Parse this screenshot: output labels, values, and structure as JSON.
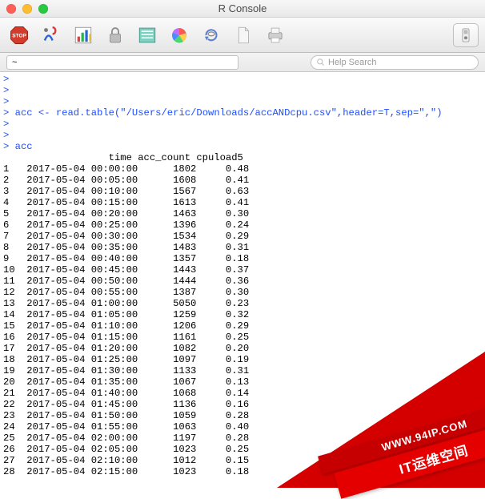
{
  "window": {
    "title": "R Console"
  },
  "toolbar": {
    "icons": {
      "stop": "stop-icon",
      "source": "source-icon",
      "chart": "chart-icon",
      "lock": "lock-icon",
      "list": "list-icon",
      "color": "color-icon",
      "refresh": "refresh-icon",
      "new": "newdoc-icon",
      "print": "print-icon",
      "prefs": "prefs-icon"
    }
  },
  "searchrow": {
    "path_value": "~",
    "help_placeholder": "Help Search"
  },
  "console": {
    "prompt": ">",
    "blank_prompts_before": 3,
    "command1": "acc <- read.table(\"/Users/eric/Downloads/accANDcpu.csv\",header=T,sep=\",\")",
    "blank_prompts_between": 2,
    "command2": "acc",
    "columns": [
      "time",
      "acc_count",
      "cpuload5"
    ],
    "rows": [
      {
        "i": "1",
        "time": "2017-05-04 00:00:00",
        "acc_count": "1802",
        "cpu": "0.48"
      },
      {
        "i": "2",
        "time": "2017-05-04 00:05:00",
        "acc_count": "1608",
        "cpu": "0.41"
      },
      {
        "i": "3",
        "time": "2017-05-04 00:10:00",
        "acc_count": "1567",
        "cpu": "0.63"
      },
      {
        "i": "4",
        "time": "2017-05-04 00:15:00",
        "acc_count": "1613",
        "cpu": "0.41"
      },
      {
        "i": "5",
        "time": "2017-05-04 00:20:00",
        "acc_count": "1463",
        "cpu": "0.30"
      },
      {
        "i": "6",
        "time": "2017-05-04 00:25:00",
        "acc_count": "1396",
        "cpu": "0.24"
      },
      {
        "i": "7",
        "time": "2017-05-04 00:30:00",
        "acc_count": "1534",
        "cpu": "0.29"
      },
      {
        "i": "8",
        "time": "2017-05-04 00:35:00",
        "acc_count": "1483",
        "cpu": "0.31"
      },
      {
        "i": "9",
        "time": "2017-05-04 00:40:00",
        "acc_count": "1357",
        "cpu": "0.18"
      },
      {
        "i": "10",
        "time": "2017-05-04 00:45:00",
        "acc_count": "1443",
        "cpu": "0.37"
      },
      {
        "i": "11",
        "time": "2017-05-04 00:50:00",
        "acc_count": "1444",
        "cpu": "0.36"
      },
      {
        "i": "12",
        "time": "2017-05-04 00:55:00",
        "acc_count": "1387",
        "cpu": "0.30"
      },
      {
        "i": "13",
        "time": "2017-05-04 01:00:00",
        "acc_count": "5050",
        "cpu": "0.23"
      },
      {
        "i": "14",
        "time": "2017-05-04 01:05:00",
        "acc_count": "1259",
        "cpu": "0.32"
      },
      {
        "i": "15",
        "time": "2017-05-04 01:10:00",
        "acc_count": "1206",
        "cpu": "0.29"
      },
      {
        "i": "16",
        "time": "2017-05-04 01:15:00",
        "acc_count": "1161",
        "cpu": "0.25"
      },
      {
        "i": "17",
        "time": "2017-05-04 01:20:00",
        "acc_count": "1082",
        "cpu": "0.20"
      },
      {
        "i": "18",
        "time": "2017-05-04 01:25:00",
        "acc_count": "1097",
        "cpu": "0.19"
      },
      {
        "i": "19",
        "time": "2017-05-04 01:30:00",
        "acc_count": "1133",
        "cpu": "0.31"
      },
      {
        "i": "20",
        "time": "2017-05-04 01:35:00",
        "acc_count": "1067",
        "cpu": "0.13"
      },
      {
        "i": "21",
        "time": "2017-05-04 01:40:00",
        "acc_count": "1068",
        "cpu": "0.14"
      },
      {
        "i": "22",
        "time": "2017-05-04 01:45:00",
        "acc_count": "1136",
        "cpu": "0.16"
      },
      {
        "i": "23",
        "time": "2017-05-04 01:50:00",
        "acc_count": "1059",
        "cpu": "0.28"
      },
      {
        "i": "24",
        "time": "2017-05-04 01:55:00",
        "acc_count": "1063",
        "cpu": "0.40"
      },
      {
        "i": "25",
        "time": "2017-05-04 02:00:00",
        "acc_count": "1197",
        "cpu": "0.28"
      },
      {
        "i": "26",
        "time": "2017-05-04 02:05:00",
        "acc_count": "1023",
        "cpu": "0.25"
      },
      {
        "i": "27",
        "time": "2017-05-04 02:10:00",
        "acc_count": "1012",
        "cpu": "0.15"
      },
      {
        "i": "28",
        "time": "2017-05-04 02:15:00",
        "acc_count": "1023",
        "cpu": "0.18"
      }
    ]
  },
  "banner": {
    "line1": "WWW.94IP.COM",
    "line2": "IT运维空间"
  },
  "chart_data": {
    "type": "table",
    "title": "acc",
    "columns": [
      "time",
      "acc_count",
      "cpuload5"
    ],
    "series": [
      {
        "name": "acc_count",
        "values": [
          1802,
          1608,
          1567,
          1613,
          1463,
          1396,
          1534,
          1483,
          1357,
          1443,
          1444,
          1387,
          5050,
          1259,
          1206,
          1161,
          1082,
          1097,
          1133,
          1067,
          1068,
          1136,
          1059,
          1063,
          1197,
          1023,
          1012,
          1023
        ]
      },
      {
        "name": "cpuload5",
        "values": [
          0.48,
          0.41,
          0.63,
          0.41,
          0.3,
          0.24,
          0.29,
          0.31,
          0.18,
          0.37,
          0.36,
          0.3,
          0.23,
          0.32,
          0.29,
          0.25,
          0.2,
          0.19,
          0.31,
          0.13,
          0.14,
          0.16,
          0.28,
          0.4,
          0.28,
          0.25,
          0.15,
          0.18
        ]
      }
    ],
    "categories": [
      "2017-05-04 00:00:00",
      "2017-05-04 00:05:00",
      "2017-05-04 00:10:00",
      "2017-05-04 00:15:00",
      "2017-05-04 00:20:00",
      "2017-05-04 00:25:00",
      "2017-05-04 00:30:00",
      "2017-05-04 00:35:00",
      "2017-05-04 00:40:00",
      "2017-05-04 00:45:00",
      "2017-05-04 00:50:00",
      "2017-05-04 00:55:00",
      "2017-05-04 01:00:00",
      "2017-05-04 01:05:00",
      "2017-05-04 01:10:00",
      "2017-05-04 01:15:00",
      "2017-05-04 01:20:00",
      "2017-05-04 01:25:00",
      "2017-05-04 01:30:00",
      "2017-05-04 01:35:00",
      "2017-05-04 01:40:00",
      "2017-05-04 01:45:00",
      "2017-05-04 01:50:00",
      "2017-05-04 01:55:00",
      "2017-05-04 02:00:00",
      "2017-05-04 02:05:00",
      "2017-05-04 02:10:00",
      "2017-05-04 02:15:00"
    ]
  }
}
